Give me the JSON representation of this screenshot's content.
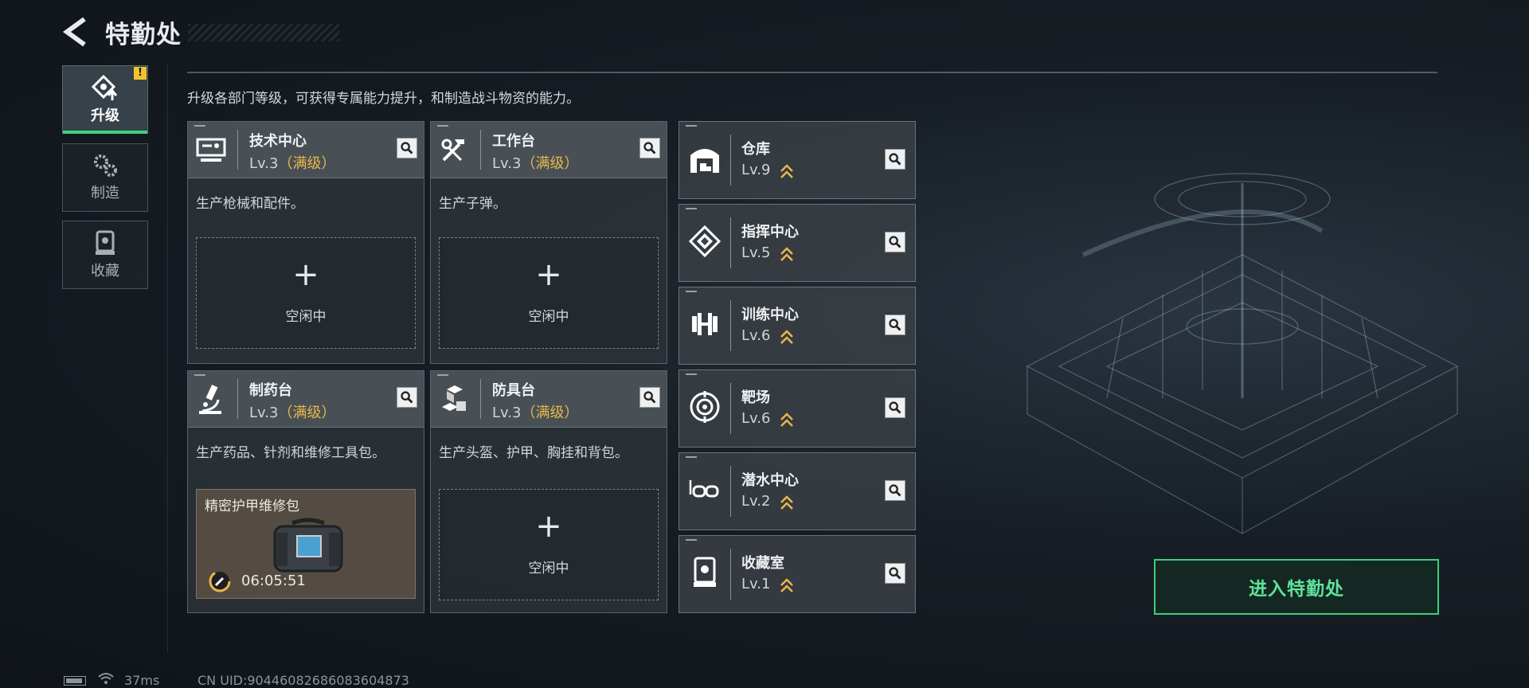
{
  "header": {
    "title": "特勤处"
  },
  "sidebar": {
    "tabs": [
      {
        "label": "升级",
        "active": true,
        "badge": "!"
      },
      {
        "label": "制造",
        "active": false
      },
      {
        "label": "收藏",
        "active": false
      }
    ]
  },
  "description": "升级各部门等级，可获得专属能力提升，和制造战斗物资的能力。",
  "big_cards": [
    {
      "name": "技术中心",
      "level": "Lv.3",
      "max": "（满级）",
      "desc": "生产枪械和配件。",
      "slot": "空闲中",
      "icon": "computer-icon"
    },
    {
      "name": "工作台",
      "level": "Lv.3",
      "max": "（满级）",
      "desc": "生产子弹。",
      "slot": "空闲中",
      "icon": "tools-icon"
    },
    {
      "name": "制药台",
      "level": "Lv.3",
      "max": "（满级）",
      "desc": "生产药品、针剂和维修工具包。",
      "icon": "microscope-icon",
      "crafting": {
        "item": "精密护甲维修包",
        "timer": "06:05:51"
      }
    },
    {
      "name": "防具台",
      "level": "Lv.3",
      "max": "（满级）",
      "desc": "生产头盔、护甲、胸挂和背包。",
      "slot": "空闲中",
      "icon": "boxes-icon"
    }
  ],
  "small_cards": [
    {
      "name": "仓库",
      "level": "Lv.9",
      "icon": "warehouse-icon"
    },
    {
      "name": "指挥中心",
      "level": "Lv.5",
      "icon": "command-icon"
    },
    {
      "name": "训练中心",
      "level": "Lv.6",
      "icon": "dumbbell-icon"
    },
    {
      "name": "靶场",
      "level": "Lv.6",
      "icon": "target-icon"
    },
    {
      "name": "潜水中心",
      "level": "Lv.2",
      "icon": "goggles-icon"
    },
    {
      "name": "收藏室",
      "level": "Lv.1",
      "icon": "trophy-case-icon"
    }
  ],
  "enter_button": "进入特勤处",
  "footer": {
    "ping": "37ms",
    "uid": "CN UID:904460826860836048​73"
  },
  "colors": {
    "accent": "#3fd37a",
    "max_level": "#e8b84a"
  }
}
